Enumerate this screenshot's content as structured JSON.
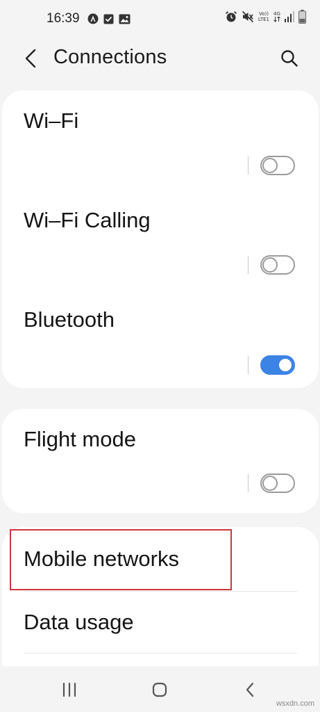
{
  "status_bar": {
    "time": "16:39",
    "left_icons": [
      "app-a-icon",
      "checkbox-icon",
      "image-icon"
    ],
    "right_icons": [
      "alarm-icon",
      "mute-icon",
      "volte-icon",
      "4g-icon",
      "signal-icon",
      "battery-icon"
    ],
    "volte_top": "Vo))",
    "volte_bottom": "LTE1",
    "network_type": "4G"
  },
  "header": {
    "title": "Connections",
    "back_icon": "chevron-left-icon",
    "search_icon": "search-icon"
  },
  "settings": {
    "wifi": {
      "title": "Wi–Fi",
      "enabled": false
    },
    "wifi_calling": {
      "title": "Wi–Fi Calling",
      "enabled": false
    },
    "bluetooth": {
      "title": "Bluetooth",
      "enabled": true
    },
    "flight_mode": {
      "title": "Flight mode",
      "enabled": false
    },
    "mobile_networks": {
      "title": "Mobile networks"
    },
    "data_usage": {
      "title": "Data usage"
    }
  },
  "nav_bar": {
    "recents_icon": "recents-icon",
    "home_icon": "home-icon",
    "back_icon": "back-icon"
  },
  "watermark": "wsxdn.com",
  "colors": {
    "accent": "#3c83e6",
    "highlight": "#d0343c",
    "background": "#f4f4f4",
    "card": "#ffffff"
  }
}
